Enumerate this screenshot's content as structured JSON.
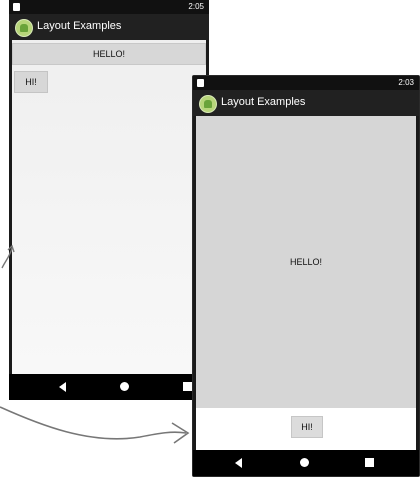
{
  "phones": [
    {
      "status_time": "2:05",
      "status_icons": "⁴ᴳ◢ ▮",
      "app_title": "Layout Examples",
      "hello_label": "HELLO!",
      "hi_label": "HI!"
    },
    {
      "status_time": "2:03",
      "status_icons": "⁴ᴳ◢ ▮",
      "app_title": "Layout Examples",
      "hello_label": "HELLO!",
      "hi_label": "HI!"
    }
  ],
  "colors": {
    "phone_frame": "#1a1a1a",
    "app_bar": "#212121",
    "button_bg": "#d7d7d7",
    "android_logo": "#8bc34a"
  },
  "icons": [
    "android-logo-icon",
    "back-icon",
    "home-icon",
    "recent-apps-icon",
    "curved-arrow-icon"
  ]
}
